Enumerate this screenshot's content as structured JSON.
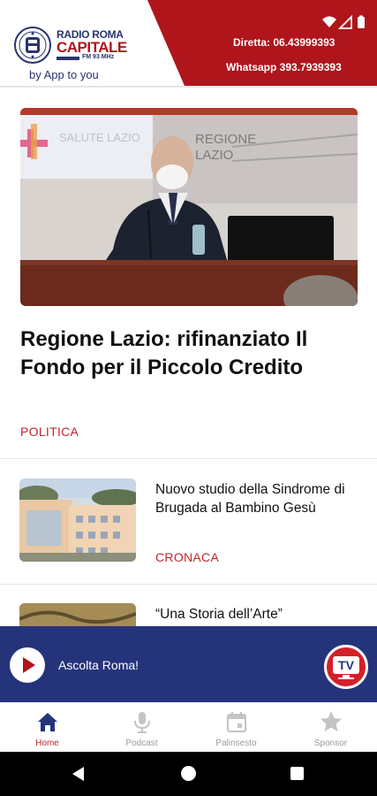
{
  "header": {
    "logo": {
      "line1": "RADIO ROMA",
      "line2": "CAPITALE",
      "line3": "FM 93 MHz"
    },
    "tagline": "by App to you",
    "contact_phone": "Diretta: 06.43999393",
    "contact_whatsapp": "Whatsapp 393.7939393",
    "brand_red": "#b0151c",
    "brand_blue": "#25347a"
  },
  "hero": {
    "title": "Regione Lazio: rifinanziato Il Fondo per il Piccolo Credito",
    "category": "POLITICA",
    "image_signs": [
      "SALUTE LAZIO",
      "REGIONE",
      "LAZIO"
    ]
  },
  "articles": [
    {
      "title": "Nuovo studio della Sindrome di Brugada al Bambino Gesù",
      "category": "CRONACA"
    },
    {
      "title": "“Una Storia dell’Arte”",
      "category": ""
    }
  ],
  "player": {
    "label": "Ascolta Roma!",
    "tv_label": "TV"
  },
  "bottom_nav": [
    {
      "label": "Home",
      "icon": "home-icon",
      "active": true
    },
    {
      "label": "Podcast",
      "icon": "microphone-icon",
      "active": false
    },
    {
      "label": "Palinsesto",
      "icon": "calendar-icon",
      "active": false
    },
    {
      "label": "Sponsor",
      "icon": "star-icon",
      "active": false
    }
  ],
  "system_nav": {
    "icons": [
      "back-icon",
      "home-circle-icon",
      "recents-icon"
    ]
  }
}
